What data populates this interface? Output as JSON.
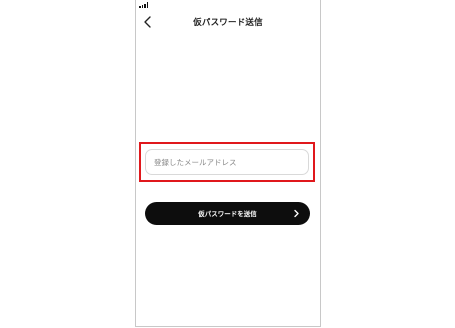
{
  "header": {
    "title": "仮パスワード送信",
    "back_icon": "chevron-left-icon"
  },
  "status_bar": {
    "signal_icon": "signal-icon"
  },
  "form": {
    "email_placeholder": "登録したメールアドレス",
    "email_value": "",
    "submit_label": "仮パスワードを送信",
    "submit_icon": "chevron-right-icon"
  },
  "colors": {
    "highlight": "#e0181c",
    "button_bg": "#0d0d0d",
    "button_text": "#ffffff"
  }
}
